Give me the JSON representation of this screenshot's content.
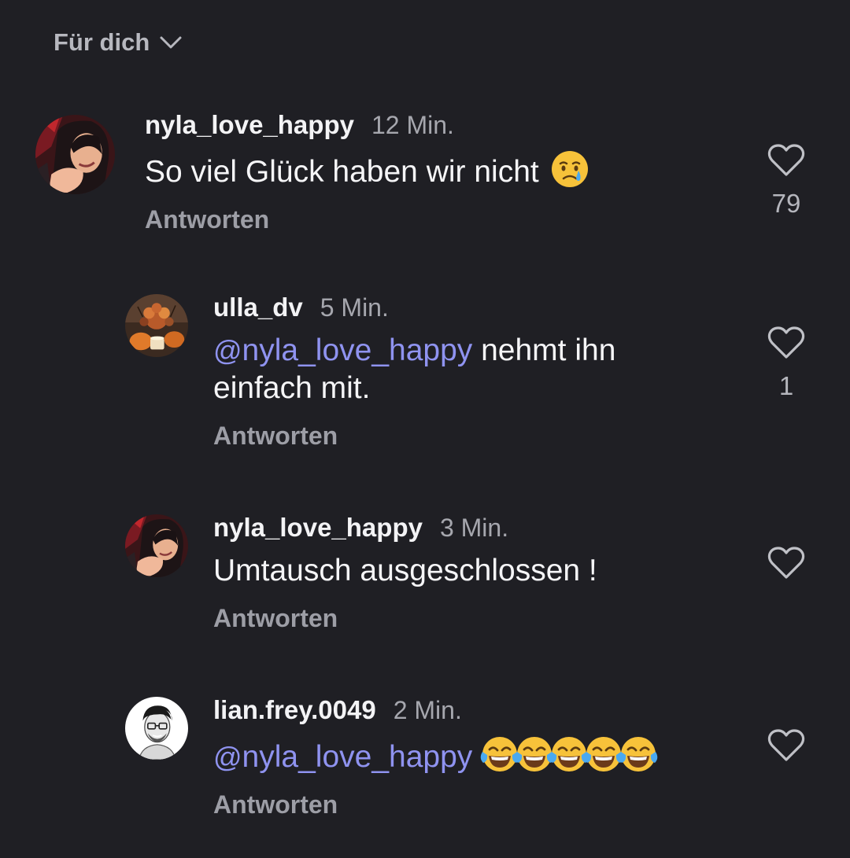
{
  "header": {
    "title": "Für dich"
  },
  "comments": [
    {
      "username": "nyla_love_happy",
      "time": "12 Min.",
      "text": "So viel Glück haben wir nicht",
      "emoji": [
        "crying-face"
      ],
      "reply_label": "Antworten",
      "likes": "79"
    },
    {
      "username": "ulla_dv",
      "time": "5 Min.",
      "mention": "nyla_love_happy",
      "text": " nehmt ihn einfach mit.",
      "reply_label": "Antworten",
      "likes": "1"
    },
    {
      "username": "nyla_love_happy",
      "time": "3 Min.",
      "text": "Umtausch ausgeschlossen !",
      "reply_label": "Antworten"
    },
    {
      "username": "lian.frey.0049",
      "time": "2 Min.",
      "mention": "nyla_love_happy",
      "emoji": [
        "laughing-tears",
        "laughing-tears",
        "laughing-tears",
        "laughing-tears",
        "laughing-tears"
      ],
      "reply_label": "Antworten"
    }
  ],
  "colors": {
    "background": "#1f1f24",
    "mention": "#8f93f0",
    "muted": "#a6a7ae"
  }
}
